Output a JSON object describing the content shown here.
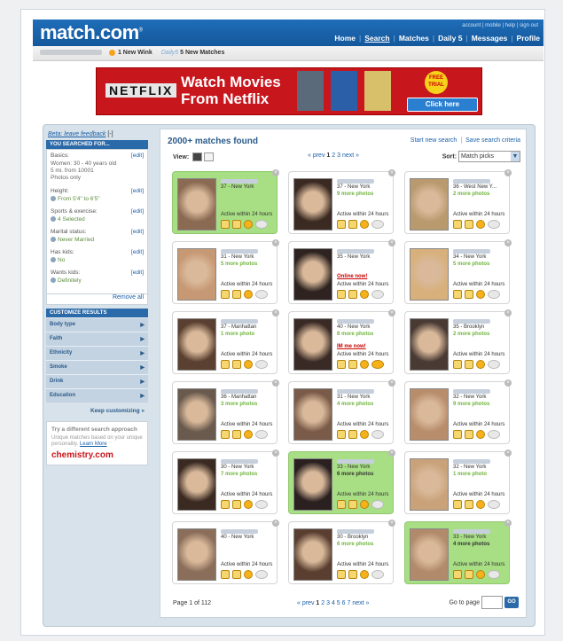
{
  "header": {
    "logo": "match.com",
    "logo_mark": "®",
    "top_links": "account | mobile | help | sign out",
    "nav": [
      "Home",
      "Search",
      "Matches",
      "Daily 5",
      "Messages",
      "Profile"
    ],
    "active_nav": "Search"
  },
  "subbar": {
    "winks": "1 New Wink",
    "daily5": "Daily5",
    "matches": "5 New Matches"
  },
  "ad": {
    "brand": "NETFLIX",
    "headline_1": "Watch Movies",
    "headline_2": "From Netflix",
    "free": "FREE TRIAL",
    "cta": "Click here",
    "accent": "#c8161d"
  },
  "sidebar": {
    "beta": "Beta: leave feedback",
    "beta_suffix": "[-]",
    "searched_for": "YOU SEARCHED FOR...",
    "criteria": [
      {
        "label": "Basics:",
        "edit": "[edit]",
        "value": "Women: 30 - 40 years old\n5 mi. from 10001\nPhotos only",
        "plain": true
      },
      {
        "label": "Height:",
        "edit": "[edit]",
        "value": "From 5'4\" to 6'5\""
      },
      {
        "label": "Sports & exercise:",
        "edit": "[edit]",
        "value": "4 Selected"
      },
      {
        "label": "Marital status:",
        "edit": "[edit]",
        "value": "Never Married"
      },
      {
        "label": "Has kids:",
        "edit": "[edit]",
        "value": "No"
      },
      {
        "label": "Wants kids:",
        "edit": "[edit]",
        "value": "Definitely"
      }
    ],
    "remove_all": "Remove all",
    "customize": "CUSTOMIZE RESULTS",
    "custom_items": [
      "Body type",
      "Faith",
      "Ethnicity",
      "Smoke",
      "Drink",
      "Education"
    ],
    "keep": "Keep customizing »",
    "chem_title": "Try a different search approach",
    "chem_sub": "Unique matches based on your unique personality.",
    "chem_link": "Learn More",
    "chem_logo": "chemistry.com"
  },
  "results": {
    "count": "2000+ matches found",
    "start_new": "Start new search",
    "save": "Save search criteria",
    "view": "View:",
    "pager_top": {
      "prev": "« prev",
      "current": "1",
      "others": "2 3",
      "next": "next »"
    },
    "sort_label": "Sort:",
    "sort_value": "Match picks",
    "active": "Active within 24 hours",
    "cards": [
      {
        "loc": "37 - New York",
        "more": "",
        "hi": true,
        "status": ""
      },
      {
        "loc": "37 - New York",
        "more": "9 more photos",
        "hi": false,
        "status": ""
      },
      {
        "loc": "36 - West New Y...",
        "more": "2 more photos",
        "hi": false,
        "status": ""
      },
      {
        "loc": "31 - New York",
        "more": "5 more photos",
        "hi": false,
        "status": ""
      },
      {
        "loc": "35 - New York",
        "more": "",
        "hi": false,
        "status": "Online now!"
      },
      {
        "loc": "34 - New York",
        "more": "5 more photos",
        "hi": false,
        "status": ""
      },
      {
        "loc": "37 - Manhattan",
        "more": "1 more photo",
        "hi": false,
        "status": ""
      },
      {
        "loc": "40 - New York",
        "more": "8 more photos",
        "hi": false,
        "status": "IM me now!"
      },
      {
        "loc": "35 - Brooklyn",
        "more": "2 more photos",
        "hi": false,
        "status": ""
      },
      {
        "loc": "36 - Manhattan",
        "more": "3 more photos",
        "hi": false,
        "status": ""
      },
      {
        "loc": "31 - New York",
        "more": "4 more photos",
        "hi": false,
        "status": ""
      },
      {
        "loc": "32 - New York",
        "more": "9 more photos",
        "hi": false,
        "status": ""
      },
      {
        "loc": "30 - New York",
        "more": "7 more photos",
        "hi": false,
        "status": ""
      },
      {
        "loc": "33 - New York",
        "more": "6 more photos",
        "hi": true,
        "status": "",
        "dark": true
      },
      {
        "loc": "32 - New York",
        "more": "1 more photo",
        "hi": false,
        "status": ""
      },
      {
        "loc": "40 - New York",
        "more": "",
        "hi": false,
        "status": ""
      },
      {
        "loc": "30 - Brooklyn",
        "more": "6 more photos",
        "hi": false,
        "status": ""
      },
      {
        "loc": "33 - New York",
        "more": "4 more photos",
        "hi": true,
        "status": "",
        "dark": true
      }
    ],
    "page_of": "Page 1 of 112",
    "pager_bottom": {
      "prev": "« prev",
      "current": "1",
      "others": "2 3 4 5 6 7",
      "next": "next »"
    },
    "goto": "Go to page",
    "go": "GO"
  },
  "icons": {
    "wink": "wink-icon",
    "email": "email-icon",
    "smile": "smile-icon",
    "chat": "chat-icon",
    "close": "close-icon"
  }
}
